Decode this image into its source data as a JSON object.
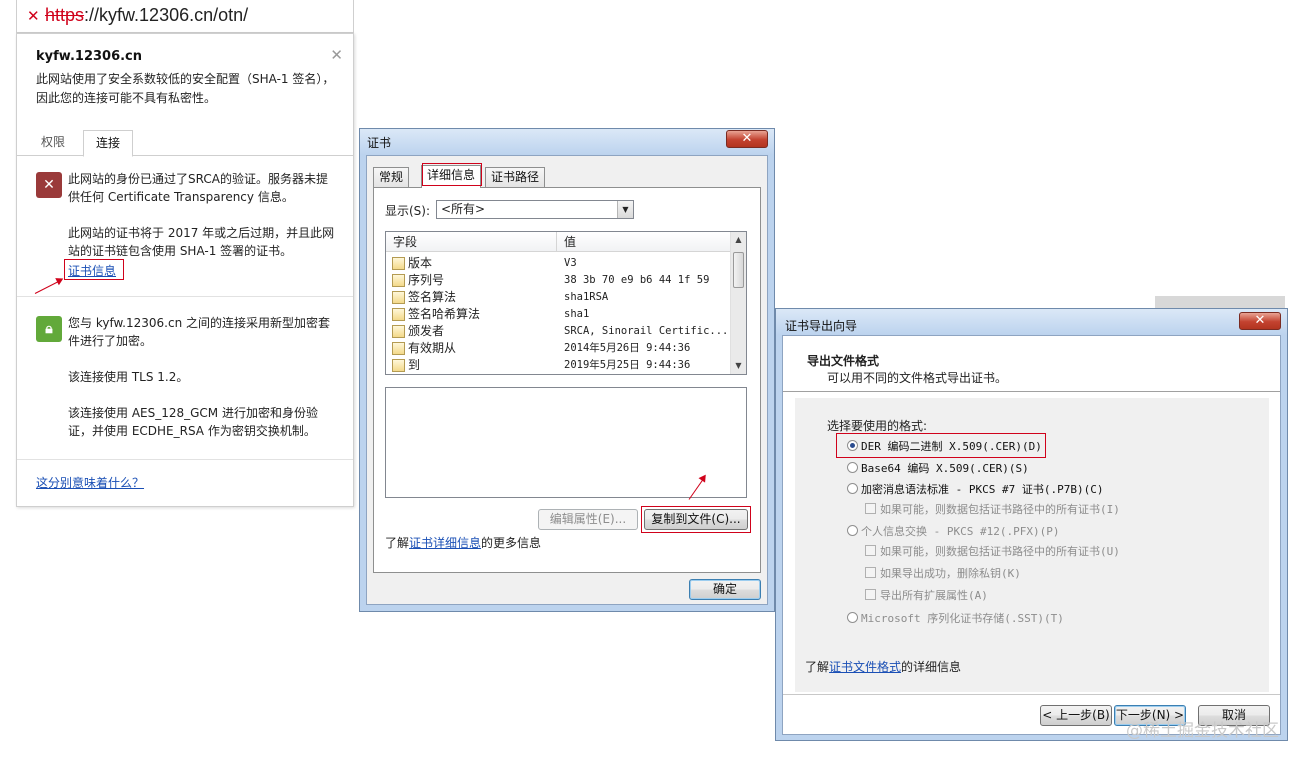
{
  "browser": {
    "url_scheme": "https",
    "url_rest": "://kyfw.12306.cn/otn/"
  },
  "popup": {
    "host": "kyfw.12306.cn",
    "warning": "此网站使用了安全系数较低的安全配置（SHA-1 签名），因此您的连接可能不具有私密性。",
    "tabs": [
      "权限",
      "连接"
    ],
    "identity_text": "此网站的身份已通过了SRCA的验证。服务器未提供任何 Certificate Transparency 信息。",
    "expiry_text": "此网站的证书将于 2017 年或之后过期，并且此网站的证书链包含使用 SHA-1 签署的证书。",
    "cert_info_link": "证书信息",
    "encrypt_text": "您与 kyfw.12306.cn 之间的连接采用新型加密套件进行了加密。",
    "tls_text": "该连接使用 TLS 1.2。",
    "cipher_text": "该连接使用 AES_128_GCM 进行加密和身份验证，并使用 ECDHE_RSA 作为密钥交换机制。",
    "meaning_link": "这分别意味着什么？"
  },
  "cert_dialog": {
    "title": "证书",
    "tabs": [
      "常规",
      "详细信息",
      "证书路径"
    ],
    "show_label": "显示(S):",
    "show_value": "<所有>",
    "columns": [
      "字段",
      "值"
    ],
    "rows": [
      {
        "field": "版本",
        "value": "V3"
      },
      {
        "field": "序列号",
        "value": "38 3b 70 e9 b6 44 1f 59"
      },
      {
        "field": "签名算法",
        "value": "sha1RSA"
      },
      {
        "field": "签名哈希算法",
        "value": "sha1"
      },
      {
        "field": "颁发者",
        "value": "SRCA, Sinorail Certific..."
      },
      {
        "field": "有效期从",
        "value": "2014年5月26日 9:44:36"
      },
      {
        "field": "到",
        "value": "2019年5月25日 9:44:36"
      }
    ],
    "edit_button": "编辑属性(E)...",
    "copy_button": "复制到文件(C)...",
    "learn_prefix": "了解",
    "learn_link": "证书详细信息",
    "learn_suffix": "的更多信息",
    "ok_button": "确定"
  },
  "export_dialog": {
    "title": "证书导出向导",
    "heading": "导出文件格式",
    "subheading": "可以用不同的文件格式导出证书。",
    "select_label": "选择要使用的格式:",
    "options": [
      {
        "label": "DER 编码二进制 X.509(.CER)(D)",
        "selected": true
      },
      {
        "label": "Base64 编码 X.509(.CER)(S)",
        "selected": false
      },
      {
        "label": "加密消息语法标准 - PKCS #7 证书(.P7B)(C)",
        "selected": false
      },
      {
        "label": "如果可能，则数据包括证书路径中的所有证书(I)"
      },
      {
        "label": "个人信息交换 - PKCS #12(.PFX)(P)",
        "selected": false
      },
      {
        "label": "如果可能，则数据包括证书路径中的所有证书(U)"
      },
      {
        "label": "如果导出成功，删除私钥(K)"
      },
      {
        "label": "导出所有扩展属性(A)"
      },
      {
        "label": "Microsoft 序列化证书存储(.SST)(T)",
        "selected": false
      }
    ],
    "learn_prefix": "了解",
    "learn_link": "证书文件格式",
    "learn_suffix": "的详细信息",
    "back_button": "< 上一步(B)",
    "next_button": "下一步(N) >",
    "cancel_button": "取消"
  },
  "watermark": "@稀土掘金技术社区",
  "colors": {
    "highlight_red": "#d0021b",
    "link_blue": "#1a4fb5",
    "win_frame": "#bcd3ee"
  }
}
